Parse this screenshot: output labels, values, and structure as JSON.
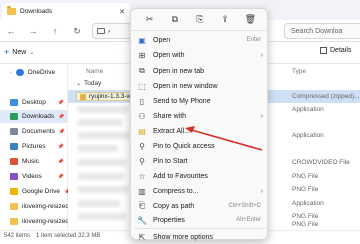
{
  "window": {
    "tab_title": "Downloads",
    "tab_close": "✕",
    "new_tab": "+",
    "address_chip": "›",
    "search_placeholder": "Search Downloa"
  },
  "command_bar": {
    "new_label": "New",
    "details_label": "Details"
  },
  "sidebar": {
    "items": [
      {
        "label": "OneDrive",
        "icon": "cloud-icon",
        "color": "#2f7ad9"
      },
      {
        "label": "Desktop",
        "icon": "desktop-icon",
        "color": "#3a8de0"
      },
      {
        "label": "Downloads",
        "icon": "download-icon",
        "color": "#2a9d5c"
      },
      {
        "label": "Documents",
        "icon": "document-icon",
        "color": "#7a8a9a"
      },
      {
        "label": "Pictures",
        "icon": "pictures-icon",
        "color": "#3b82c4"
      },
      {
        "label": "Music",
        "icon": "music-icon",
        "color": "#e0513a"
      },
      {
        "label": "Videos",
        "icon": "video-icon",
        "color": "#8a4fc4"
      },
      {
        "label": "Google Drive",
        "icon": "google-drive-icon",
        "color": "#f0b400"
      },
      {
        "label": "iloveimg-resized",
        "icon": "folder-icon",
        "color": "#f2c14e"
      },
      {
        "label": "iloveimg-resized",
        "icon": "folder-icon",
        "color": "#f2c14e"
      }
    ]
  },
  "file_list": {
    "col_name": "Name",
    "col_type": "Type",
    "group_label": "Today",
    "selected_file": "ryujinx-1.3.3-win",
    "types": [
      "Compressed (zipped)...",
      "Application",
      "",
      "Application",
      "",
      "CROWDVIDEO File",
      "PNG File",
      "PNG File",
      "Application",
      "PNG File",
      "PNG File",
      "PNG File"
    ]
  },
  "status": {
    "items": "542 items",
    "selected": "1 item selected  32.3 MB"
  },
  "context_menu": {
    "toolbar_icons": [
      "cut-icon",
      "copy-icon",
      "rename-icon",
      "share-icon",
      "delete-icon"
    ],
    "items": [
      {
        "label": "Open",
        "shortcut": "Enter",
        "icon": "open-icon"
      },
      {
        "label": "Open with",
        "arrow": "›",
        "icon": "open-with-icon"
      },
      {
        "label": "Open in new tab",
        "icon": "new-tab-icon"
      },
      {
        "label": "Open in new window",
        "icon": "new-window-icon"
      },
      {
        "label": "Send to My Phone",
        "icon": "phone-icon"
      },
      {
        "label": "Share with",
        "arrow": "›",
        "icon": "share-with-icon"
      },
      {
        "label": "Extract All...",
        "icon": "extract-icon"
      },
      {
        "label": "Pin to Quick access",
        "icon": "pin-icon"
      },
      {
        "label": "Pin to Start",
        "icon": "pin-start-icon"
      },
      {
        "label": "Add to Favourites",
        "icon": "star-icon"
      },
      {
        "label": "Compress to...",
        "arrow": "›",
        "icon": "compress-icon"
      },
      {
        "label": "Copy as path",
        "shortcut": "Ctrl+Shift+C",
        "icon": "copy-path-icon"
      },
      {
        "label": "Properties",
        "shortcut": "Alt+Enter",
        "icon": "properties-icon"
      },
      {
        "label": "Show more options",
        "icon": "more-options-icon"
      }
    ]
  },
  "annotation_color": "#d93025"
}
